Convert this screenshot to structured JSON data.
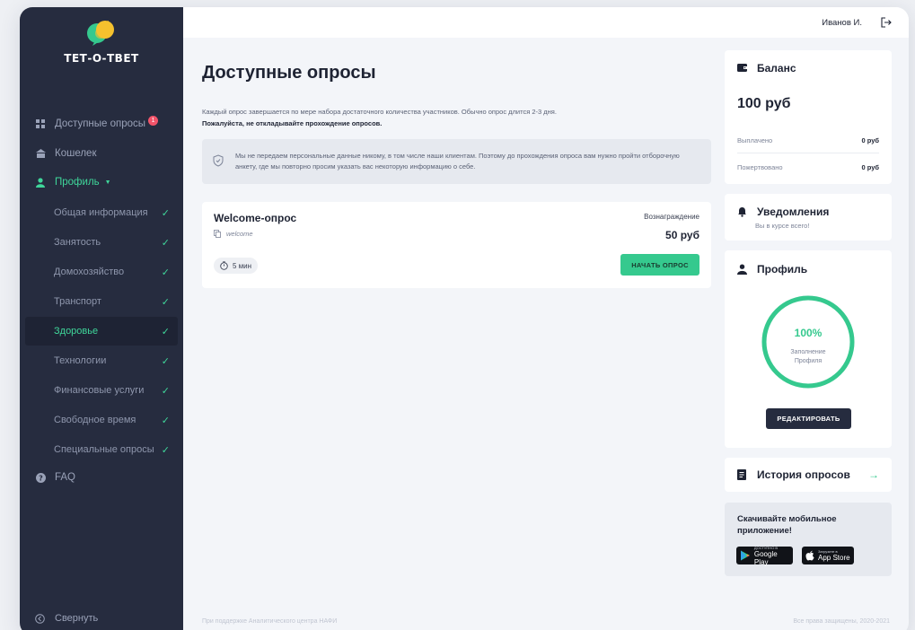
{
  "brand": {
    "name": "ТЕТ-О-ТВЕТ"
  },
  "colors": {
    "sidebar": "#262c3f",
    "accent": "#35c98e",
    "badge": "#f2546a",
    "page_bg": "#f3f5f9"
  },
  "sidebar": {
    "items": [
      {
        "label": "Доступные опросы",
        "icon": "grid-icon",
        "badge": "1"
      },
      {
        "label": "Кошелек",
        "icon": "wallet-icon"
      },
      {
        "label": "Профиль",
        "icon": "user-icon",
        "expanded": true
      }
    ],
    "profile_sections": [
      {
        "label": "Общая информация",
        "done": true
      },
      {
        "label": "Занятость",
        "done": true
      },
      {
        "label": "Домохозяйство",
        "done": true
      },
      {
        "label": "Транспорт",
        "done": true
      },
      {
        "label": "Здоровье",
        "done": true,
        "current": true
      },
      {
        "label": "Технологии",
        "done": true
      },
      {
        "label": "Финансовые услуги",
        "done": true
      },
      {
        "label": "Свободное время",
        "done": true
      },
      {
        "label": "Специальные опросы",
        "done": true
      }
    ],
    "faq": "FAQ",
    "collapse": "Свернуть"
  },
  "header": {
    "user": "Иванов И."
  },
  "main": {
    "title": "Доступные опросы",
    "desc_line1": "Каждый опрос завершается по мере набора достаточного количества участников. Обычно опрос длится 2-3 дня.",
    "desc_line2": "Пожалуйста, не откладывайте прохождение опросов.",
    "notice": "Мы не передаем персональные данные никому, в том числе наши клиентам. Поэтому до прохождения опроса вам нужно пройти отборочную анкету, где мы повторно просим указать вас некоторую информацию о себе.",
    "survey": {
      "title": "Welcome-опрос",
      "code": "welcome",
      "reward_label": "Вознаграждение",
      "reward": "50 руб",
      "duration": "5 мин",
      "start_label": "НАЧАТЬ ОПРОС"
    }
  },
  "balance": {
    "title": "Баланс",
    "amount": "100 руб",
    "rows": [
      {
        "label": "Выплачено",
        "value": "0 руб"
      },
      {
        "label": "Пожертвовано",
        "value": "0 руб"
      }
    ]
  },
  "notifications": {
    "title": "Уведомления",
    "subtitle": "Вы в курсе всего!"
  },
  "profile": {
    "title": "Профиль",
    "percent_text": "100%",
    "completion": 1.0,
    "caption_line1": "Заполнение",
    "caption_line2": "Профиля",
    "edit_label": "РЕДАКТИРОВАТЬ"
  },
  "history": {
    "title": "История опросов"
  },
  "app": {
    "text": "Скачивайте мобильное приложение!",
    "google_small": "ДОСТУПНО В",
    "google": "Google Play",
    "apple_small": "Загрузите в",
    "apple": "App Store"
  },
  "footer": {
    "left": "При поддержке Аналитического центра НАФИ",
    "right": "Все права защищены, 2020-2021"
  }
}
